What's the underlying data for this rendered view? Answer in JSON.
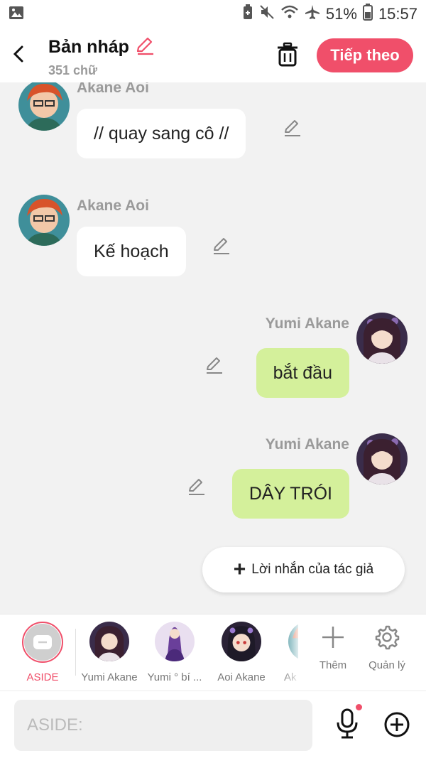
{
  "status_bar": {
    "battery": "51%",
    "time": "15:57",
    "icons": [
      "image-icon",
      "battery-saver-icon",
      "mute-icon",
      "wifi-icon",
      "airplane-icon",
      "battery-icon"
    ]
  },
  "header": {
    "title": "Bản nháp",
    "word_count": "351 chữ",
    "next_label": "Tiếp theo"
  },
  "messages": [
    {
      "sender": "Akane Aoi",
      "text": "// quay sang cô //",
      "side": "left"
    },
    {
      "sender": "Akane Aoi",
      "text": "Kế hoạch",
      "side": "left"
    },
    {
      "sender": "Yumi Akane",
      "text": "bắt đầu",
      "side": "right"
    },
    {
      "sender": "Yumi Akane",
      "text": "DÂY TRÓI",
      "side": "right"
    }
  ],
  "author_note": {
    "label": "Lời nhắn của tác giả"
  },
  "characters": [
    {
      "name": "ASIDE",
      "selected": true
    },
    {
      "name": "Yumi Akane"
    },
    {
      "name": "Yumi ° bí ..."
    },
    {
      "name": "Aoi Akane"
    },
    {
      "name": "Ak"
    }
  ],
  "tools": {
    "add_label": "Thêm",
    "manage_label": "Quản lý"
  },
  "input": {
    "placeholder": "ASIDE:"
  },
  "colors": {
    "accent": "#f04f6a",
    "bubble_right": "#d4f09b",
    "bubble_left": "#ffffff",
    "background": "#f2f2f2"
  }
}
